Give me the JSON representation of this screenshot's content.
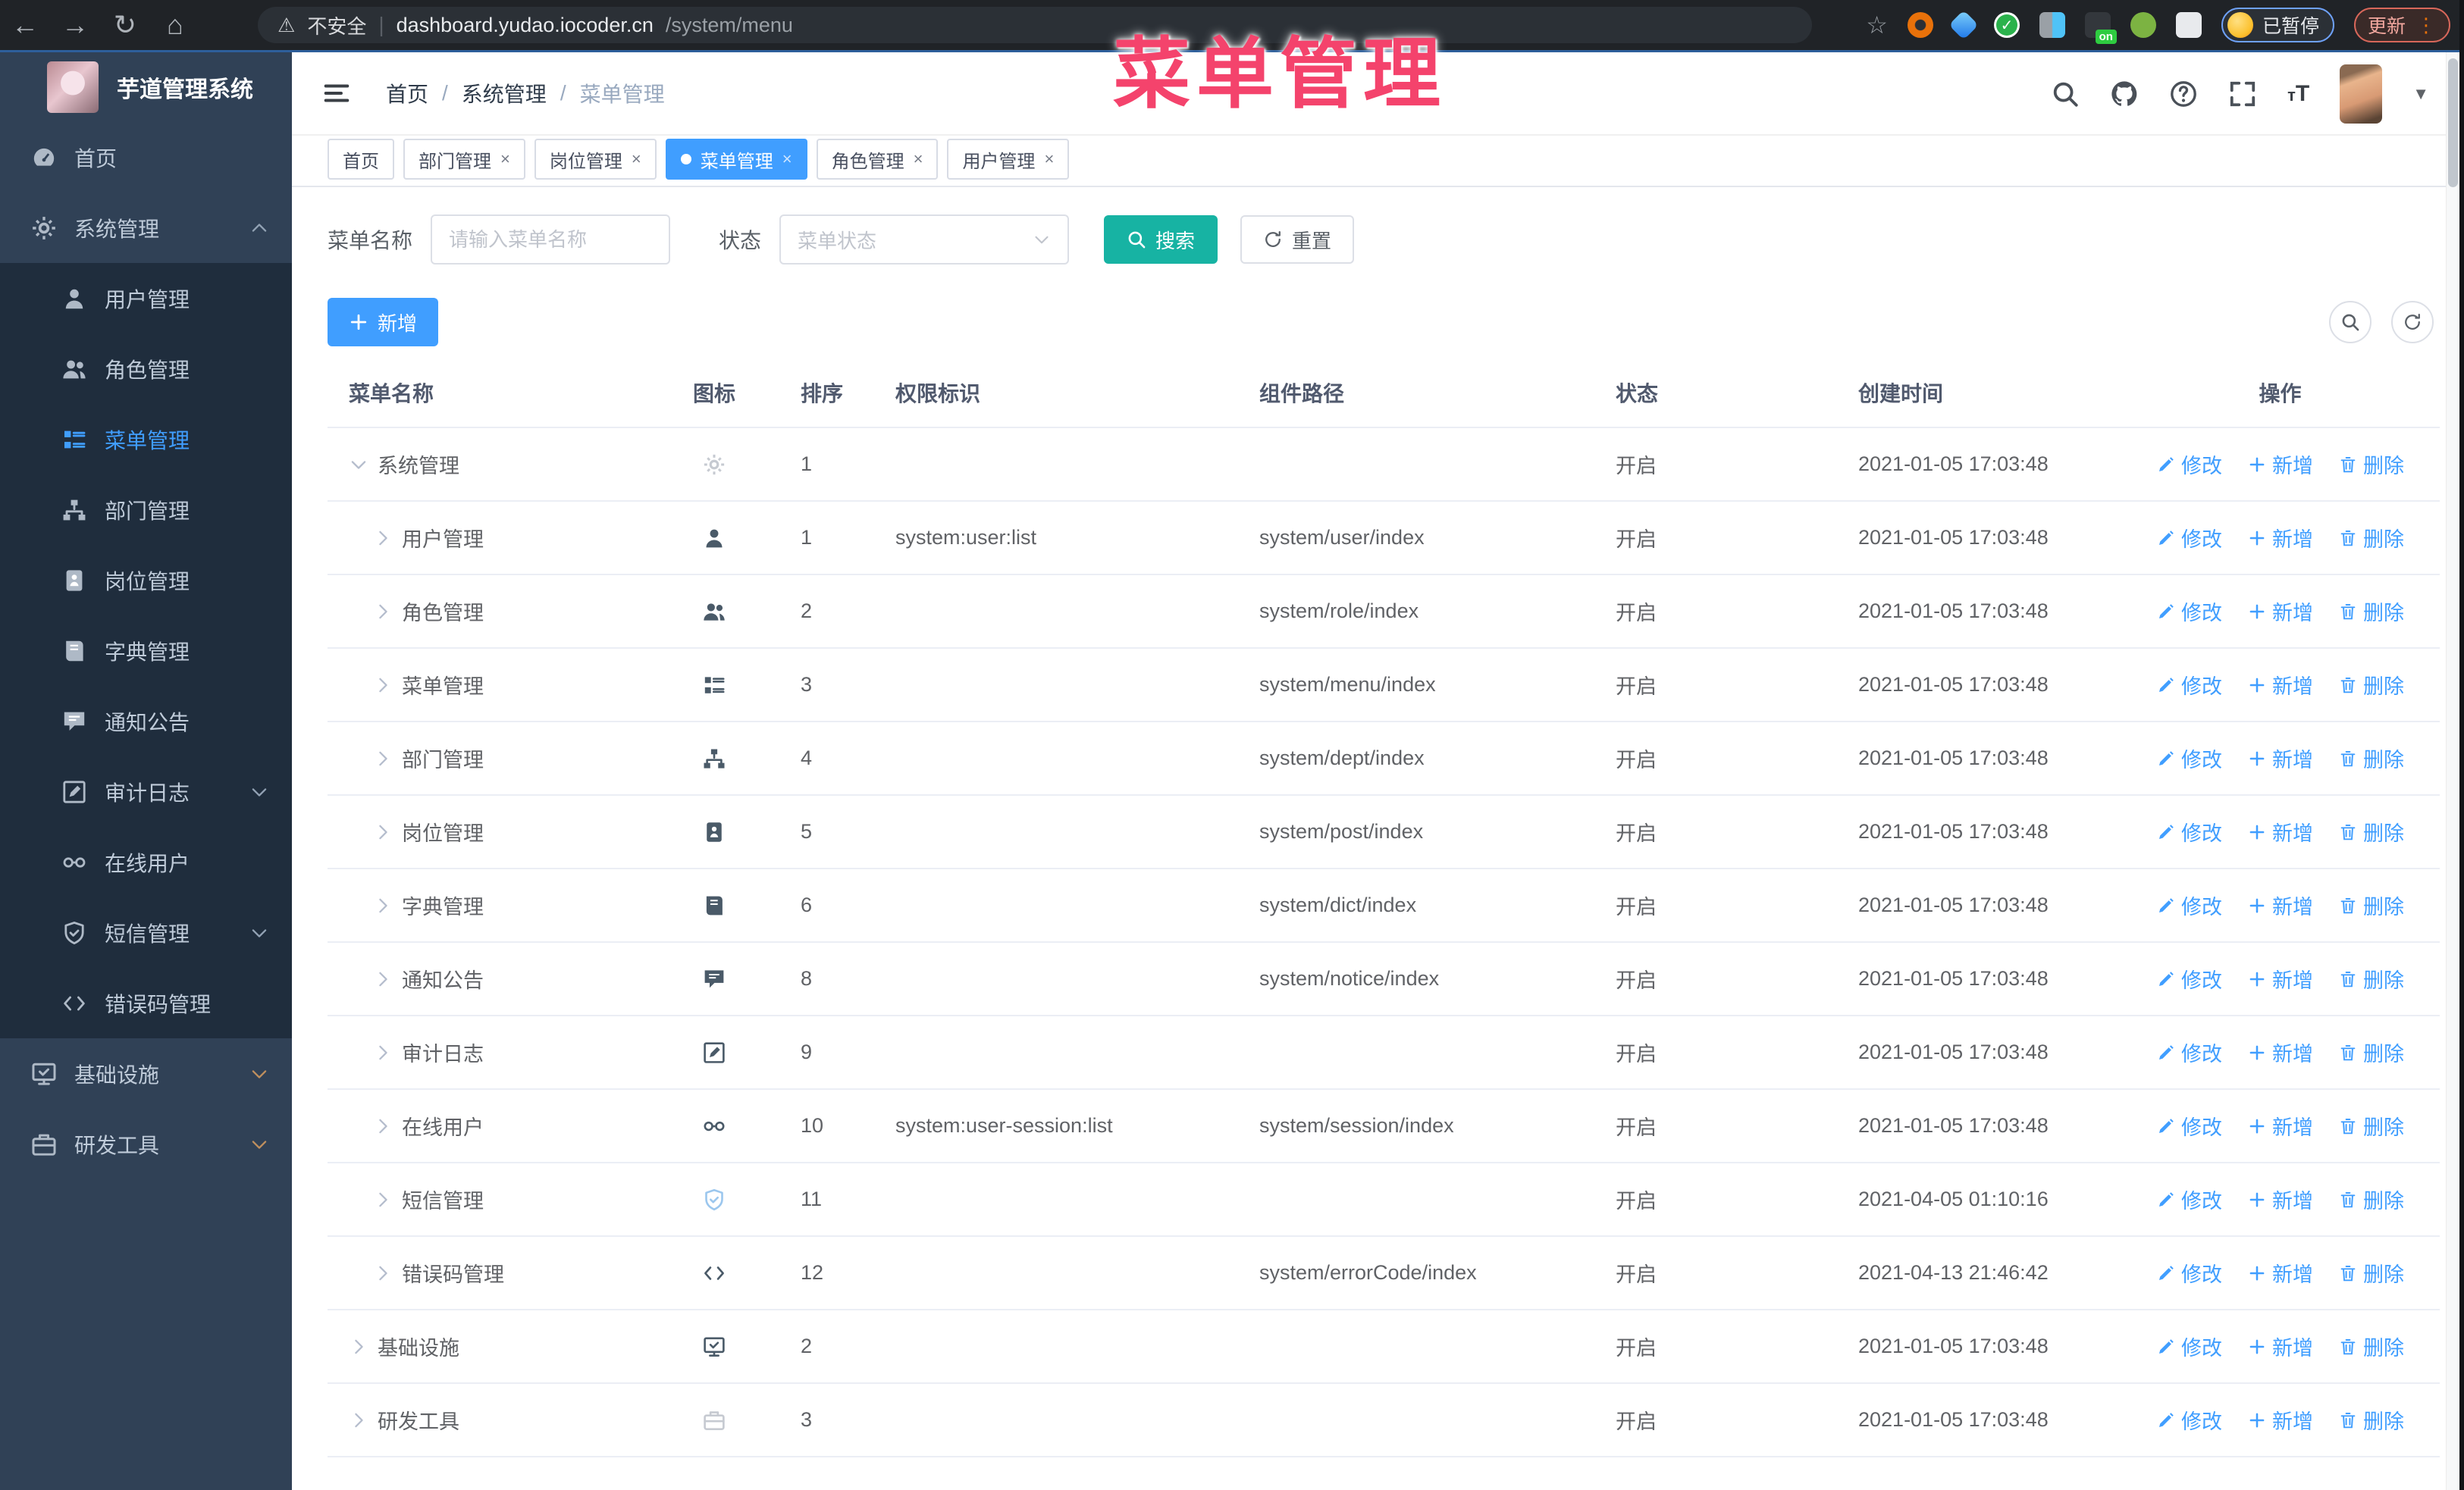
{
  "browser": {
    "unsafe_label": "不安全",
    "url": "dashboard.yudao.iocoder.cn",
    "url_path": "/system/menu",
    "paused_label": "已暂停",
    "update_label": "更新"
  },
  "overlay": {
    "title": "菜单管理"
  },
  "colors": {
    "accent": "#409eff",
    "search_button": "#17b3a3",
    "overlay_title": "#f4436c",
    "sidebar_bg": "#304156",
    "submenu_bg": "#1f2d3d",
    "active_tab": "#409eff"
  },
  "sidebar": {
    "logo_title": "芋道管理系统",
    "items": [
      {
        "key": "home",
        "label": "首页",
        "icon": "dashboard-icon",
        "level": 0
      },
      {
        "key": "system",
        "label": "系统管理",
        "icon": "gear-icon",
        "level": 0,
        "caret": "up"
      },
      {
        "key": "user",
        "label": "用户管理",
        "icon": "user-icon",
        "level": 1
      },
      {
        "key": "role",
        "label": "角色管理",
        "icon": "users-icon",
        "level": 1
      },
      {
        "key": "menu",
        "label": "菜单管理",
        "icon": "menu-icon",
        "level": 1,
        "active": true
      },
      {
        "key": "dept",
        "label": "部门管理",
        "icon": "tree-icon",
        "level": 1
      },
      {
        "key": "post",
        "label": "岗位管理",
        "icon": "badge-icon",
        "level": 1
      },
      {
        "key": "dict",
        "label": "字典管理",
        "icon": "book-icon",
        "level": 1
      },
      {
        "key": "notice",
        "label": "通知公告",
        "icon": "megaphone-icon",
        "level": 1
      },
      {
        "key": "audit-log",
        "label": "审计日志",
        "icon": "edit-icon",
        "level": 1,
        "caret": "down"
      },
      {
        "key": "online-user",
        "label": "在线用户",
        "icon": "online-icon",
        "level": 1
      },
      {
        "key": "sms",
        "label": "短信管理",
        "icon": "shield-icon",
        "level": 1,
        "caret": "down"
      },
      {
        "key": "error-code",
        "label": "错误码管理",
        "icon": "code-icon",
        "level": 1
      },
      {
        "key": "infra",
        "label": "基础设施",
        "icon": "monitor-icon",
        "level": 0,
        "caret": "down",
        "warm": true
      },
      {
        "key": "dev-tools",
        "label": "研发工具",
        "icon": "toolbox-icon",
        "level": 0,
        "caret": "down",
        "warm": true
      }
    ]
  },
  "header": {
    "breadcrumb": [
      "首页",
      "系统管理",
      "菜单管理"
    ]
  },
  "tabs": [
    {
      "key": "home",
      "label": "首页",
      "closable": false
    },
    {
      "key": "dept",
      "label": "部门管理",
      "closable": true
    },
    {
      "key": "post",
      "label": "岗位管理",
      "closable": true
    },
    {
      "key": "menu",
      "label": "菜单管理",
      "closable": true,
      "active": true
    },
    {
      "key": "role",
      "label": "角色管理",
      "closable": true
    },
    {
      "key": "user",
      "label": "用户管理",
      "closable": true
    }
  ],
  "filters": {
    "name_label": "菜单名称",
    "name_placeholder": "请输入菜单名称",
    "status_label": "状态",
    "status_placeholder": "菜单状态",
    "search_label": "搜索",
    "reset_label": "重置"
  },
  "toolbar": {
    "add_label": "新增"
  },
  "table": {
    "columns": [
      "菜单名称",
      "图标",
      "排序",
      "权限标识",
      "组件路径",
      "状态",
      "创建时间",
      "操作"
    ],
    "action_labels": {
      "edit": "修改",
      "add": "新增",
      "delete": "删除"
    },
    "rows": [
      {
        "key": "system",
        "name": "系统管理",
        "level": 0,
        "expanded": true,
        "icon": "gear-icon",
        "tint": "light",
        "sort": "1",
        "perm": "",
        "path": "",
        "status": "开启",
        "created": "2021-01-05 17:03:48"
      },
      {
        "key": "user",
        "name": "用户管理",
        "level": 1,
        "icon": "user-icon",
        "sort": "1",
        "perm": "system:user:list",
        "path": "system/user/index",
        "status": "开启",
        "created": "2021-01-05 17:03:48"
      },
      {
        "key": "role",
        "name": "角色管理",
        "level": 1,
        "icon": "users-icon",
        "sort": "2",
        "perm": "",
        "path": "system/role/index",
        "status": "开启",
        "created": "2021-01-05 17:03:48"
      },
      {
        "key": "menu",
        "name": "菜单管理",
        "level": 1,
        "icon": "menu-icon",
        "sort": "3",
        "perm": "",
        "path": "system/menu/index",
        "status": "开启",
        "created": "2021-01-05 17:03:48"
      },
      {
        "key": "dept",
        "name": "部门管理",
        "level": 1,
        "icon": "tree-icon",
        "sort": "4",
        "perm": "",
        "path": "system/dept/index",
        "status": "开启",
        "created": "2021-01-05 17:03:48"
      },
      {
        "key": "post",
        "name": "岗位管理",
        "level": 1,
        "icon": "badge-icon",
        "sort": "5",
        "perm": "",
        "path": "system/post/index",
        "status": "开启",
        "created": "2021-01-05 17:03:48"
      },
      {
        "key": "dict",
        "name": "字典管理",
        "level": 1,
        "icon": "book-icon",
        "sort": "6",
        "perm": "",
        "path": "system/dict/index",
        "status": "开启",
        "created": "2021-01-05 17:03:48"
      },
      {
        "key": "notice",
        "name": "通知公告",
        "level": 1,
        "icon": "megaphone-icon",
        "sort": "8",
        "perm": "",
        "path": "system/notice/index",
        "status": "开启",
        "created": "2021-01-05 17:03:48"
      },
      {
        "key": "audit-log",
        "name": "审计日志",
        "level": 1,
        "icon": "edit-icon",
        "sort": "9",
        "perm": "",
        "path": "",
        "status": "开启",
        "created": "2021-01-05 17:03:48"
      },
      {
        "key": "online-user",
        "name": "在线用户",
        "level": 1,
        "icon": "online-icon",
        "sort": "10",
        "perm": "system:user-session:list",
        "path": "system/session/index",
        "status": "开启",
        "created": "2021-01-05 17:03:48"
      },
      {
        "key": "sms",
        "name": "短信管理",
        "level": 1,
        "icon": "shield-icon",
        "tint": "soft-blue",
        "sort": "11",
        "perm": "",
        "path": "",
        "status": "开启",
        "created": "2021-04-05 01:10:16"
      },
      {
        "key": "error-code",
        "name": "错误码管理",
        "level": 1,
        "icon": "code-icon",
        "sort": "12",
        "perm": "",
        "path": "system/errorCode/index",
        "status": "开启",
        "created": "2021-04-13 21:46:42"
      },
      {
        "key": "infra",
        "name": "基础设施",
        "level": 0,
        "icon": "monitor-icon",
        "sort": "2",
        "perm": "",
        "path": "",
        "status": "开启",
        "created": "2021-01-05 17:03:48"
      },
      {
        "key": "dev-tools",
        "name": "研发工具",
        "level": 0,
        "icon": "toolbox-icon",
        "tint": "light",
        "sort": "3",
        "perm": "",
        "path": "",
        "status": "开启",
        "created": "2021-01-05 17:03:48"
      }
    ]
  }
}
